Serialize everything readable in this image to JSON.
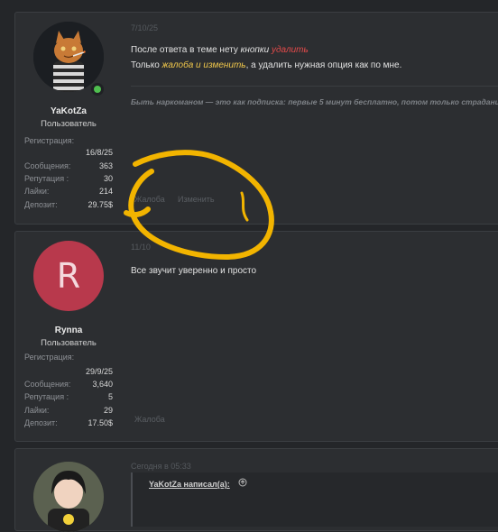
{
  "posts": [
    {
      "date": "7/10/25",
      "user": {
        "name": "YaKotZa",
        "role": "Пользователь",
        "reg_label": "Регистрация:",
        "reg_value": "16/8/25",
        "stats": [
          {
            "label": "Сообщения:",
            "value": "363"
          },
          {
            "label": "Репутация :",
            "value": "30"
          },
          {
            "label": "Лайки:",
            "value": "214"
          },
          {
            "label": "Депозит:",
            "value": "29.75$"
          }
        ]
      },
      "message": {
        "line1_a": "После ответа в теме нету ",
        "line1_b": "кнопки",
        "line1_c": " удалить",
        "line2_a": "Только ",
        "line2_b": "жалоба",
        "line2_c": " и ",
        "line2_d": "изменить",
        "line2_e": ", а удалить нужная опция как по мне."
      },
      "signature": "Быть наркоманом — это как подписка: первые 5 минут бесплатно, потом только страдани",
      "actions": [
        "Жалоба",
        "Изменить"
      ]
    },
    {
      "date": "11/10",
      "user": {
        "avatar_letter": "R",
        "name": "Rynna",
        "role": "Пользователь",
        "reg_label": "Регистрация:",
        "reg_value": "29/9/25",
        "stats": [
          {
            "label": "Сообщения:",
            "value": "3,640"
          },
          {
            "label": "Репутация :",
            "value": "5"
          },
          {
            "label": "Лайки:",
            "value": "29"
          },
          {
            "label": "Депозит:",
            "value": "17.50$"
          }
        ]
      },
      "message": "Все звучит уверенно и просто",
      "actions": [
        "Жалоба"
      ]
    },
    {
      "date": "Сегодня в 05:33",
      "quote_author": "YaKotZa написал(а):"
    }
  ],
  "colors": {
    "accent_red": "#e24a4a",
    "accent_yellow": "#f1c84b",
    "annotation": "#f2b400",
    "avatar_r": "#b8394c"
  }
}
